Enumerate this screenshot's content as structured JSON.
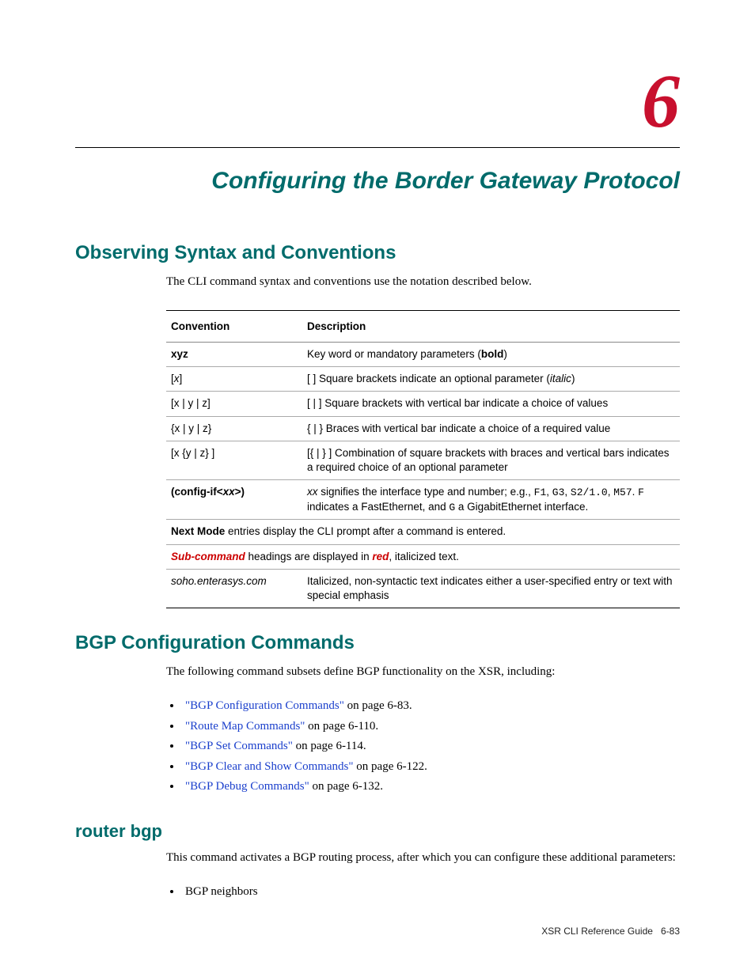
{
  "chapter": {
    "number": "6",
    "title": "Configuring the Border Gateway Protocol"
  },
  "section1": {
    "title": "Observing Syntax and Conventions",
    "intro": "The CLI command syntax and conventions use the notation described below."
  },
  "table": {
    "head_convention": "Convention",
    "head_description": "Description",
    "rows": {
      "r1": {
        "conv": "xyz",
        "desc_pre": "Key word or mandatory parameters (",
        "desc_bold": "bold",
        "desc_post": ")"
      },
      "r2": {
        "conv_open": "[",
        "conv_var": "x",
        "conv_close": "]",
        "desc_pre": "[ ] Square brackets indicate an optional parameter (",
        "desc_ital": "italic",
        "desc_post": ")"
      },
      "r3": {
        "conv": "[x | y | z]",
        "desc": "[ | ] Square brackets with vertical bar indicate a choice of values"
      },
      "r4": {
        "conv": "{x | y | z}",
        "desc": "{ | } Braces with vertical bar indicate a choice of a required value"
      },
      "r5": {
        "conv": "[x {y | z} ]",
        "desc": "[{ | } ] Combination of square brackets with braces and vertical bars indicates a required choice of an optional parameter"
      },
      "r6": {
        "conv_pre": "(config-if<",
        "conv_var": "xx",
        "conv_post": ">)",
        "desc_parts": {
          "a": "xx",
          "b": " signifies the interface type and number; e.g., ",
          "c": "F1",
          "d": ", ",
          "e": "G3",
          "f": ", ",
          "g": "S2/1.0",
          "h": ", ",
          "i": "M57",
          "j": ". ",
          "k": "F",
          "l": " indicates a FastEthernet, and ",
          "m": "G",
          "n": " a GigabitEthernet interface."
        }
      },
      "r7": {
        "a": "Next Mode",
        "b": " entries display the CLI prompt after a command is entered."
      },
      "r8": {
        "a": "Sub-command",
        "b": " headings are displayed in ",
        "c": "red",
        "d": ", italicized text."
      },
      "r9": {
        "conv": "soho.enterasys.com",
        "desc": "Italicized, non-syntactic text indicates either a user-specified entry or text with special emphasis"
      }
    }
  },
  "section2": {
    "title": "BGP Configuration Commands",
    "intro": "The following command subsets define BGP functionality on the XSR, including:",
    "items": {
      "i1": {
        "link": "\"BGP Configuration Commands\"",
        "suffix": " on page 6-83."
      },
      "i2": {
        "link": "\"Route Map Commands\"",
        "suffix": " on page 6-110."
      },
      "i3": {
        "link": "\"BGP Set Commands\"",
        "suffix": " on page 6-114."
      },
      "i4": {
        "link": "\"BGP Clear and Show Commands\"",
        "suffix": " on page 6-122."
      },
      "i5": {
        "link": "\"BGP Debug Commands\"",
        "suffix": " on page 6-132."
      }
    }
  },
  "section3": {
    "title": "router bgp",
    "intro": "This command activates a BGP routing process, after which you can configure these additional parameters:",
    "item1": "BGP neighbors"
  },
  "footer": {
    "guide": "XSR CLI Reference Guide",
    "page": "6-83"
  }
}
